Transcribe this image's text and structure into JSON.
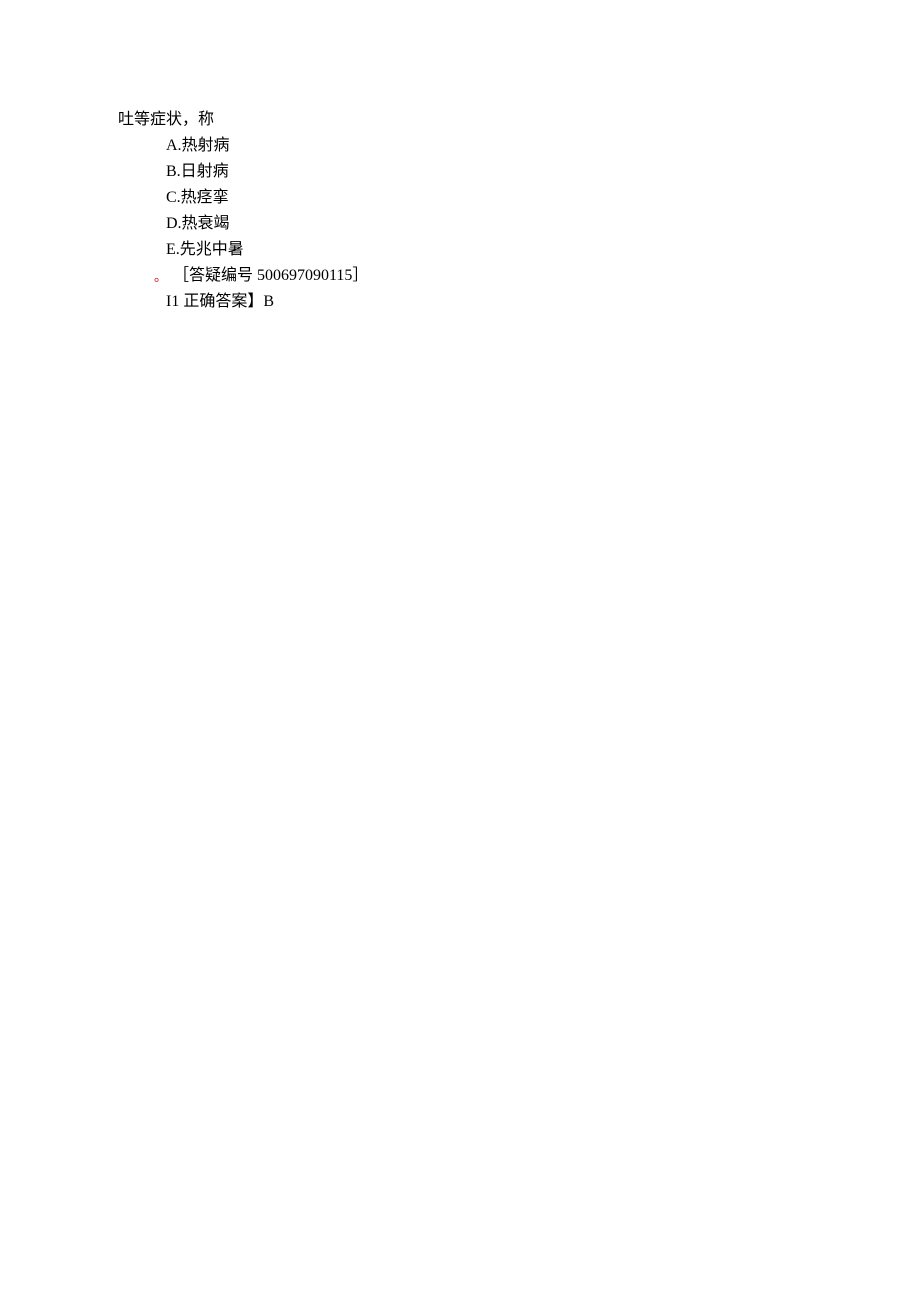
{
  "intro": "吐等症状，称",
  "options": {
    "a": "A.热射病",
    "b": "B.日射病",
    "c": "C.热痉挛",
    "d": "D.热衰竭",
    "e": "E.先兆中暑"
  },
  "note": {
    "marker": "。",
    "text": "［答疑编号 500697090115］"
  },
  "answer": "I1 正确答案】B"
}
